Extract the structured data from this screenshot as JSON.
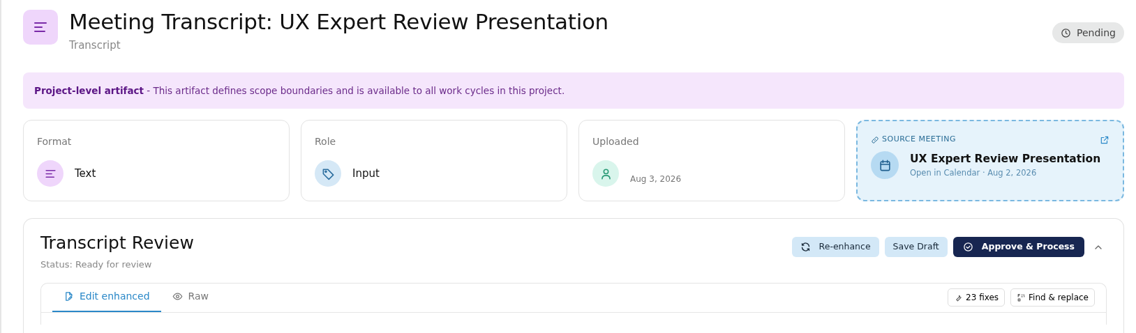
{
  "header": {
    "title": "Meeting Transcript: UX Expert Review Presentation",
    "subtitle": "Transcript",
    "status": "Pending"
  },
  "banner": {
    "text": "**Project-level artifact** - This artifact defines scope boundaries and is available to all work cycles in this project."
  },
  "info_cards": [
    {
      "kind": "format",
      "label": "Format",
      "value": "Text"
    },
    {
      "kind": "role",
      "label": "Role",
      "value": "Input"
    },
    {
      "kind": "uploaded",
      "label": "Uploaded",
      "value": "Aug 3, 2026"
    }
  ],
  "source_meeting": {
    "label": "SOURCE MEETING",
    "title": "UX Expert Review Presentation",
    "subtitle": "Open in Calendar · Aug 2, 2026"
  },
  "review": {
    "title": "Transcript Review",
    "status": "Status: Ready for review",
    "expanded": true,
    "buttons": [
      {
        "kind": "reenhance",
        "label": "Re-enhance"
      },
      {
        "kind": "draft",
        "label": "Save Draft"
      },
      {
        "kind": "approve",
        "label": "Approve & Process"
      }
    ],
    "tabs": [
      {
        "kind": "edit",
        "label": "Edit enhanced",
        "selected": true
      },
      {
        "kind": "raw",
        "label": "Raw",
        "selected": false
      }
    ],
    "tools": [
      {
        "kind": "fixes",
        "label": "23 fixes"
      },
      {
        "kind": "find",
        "label": "Find & replace"
      }
    ]
  }
}
